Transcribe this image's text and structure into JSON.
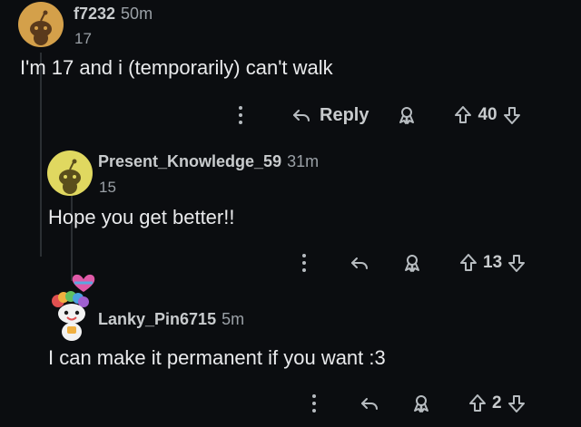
{
  "comments": [
    {
      "username": "f7232",
      "time": "50m",
      "flair": "17",
      "body": "I'm 17 and i (temporarily) can't walk",
      "reply_label": "Reply",
      "votes": "40",
      "avatar_color": "#d4a04a"
    },
    {
      "username": "Present_Knowledge_59",
      "time": "31m",
      "flair": "15",
      "body": "Hope you get better!!",
      "votes": "13",
      "avatar_color": "#e0d860"
    },
    {
      "username": "Lanky_Pin6715",
      "time": "5m",
      "body": "I can make it permanent if you want :3",
      "votes": "2"
    }
  ],
  "icons": {
    "more": "more-options-icon",
    "reply": "reply-arrow-icon",
    "award": "award-icon",
    "upvote": "upvote-arrow-icon",
    "downvote": "downvote-arrow-icon"
  },
  "colors": {
    "background": "#0b0d10",
    "text": "#e9eaec",
    "muted": "#9aa0a6"
  }
}
